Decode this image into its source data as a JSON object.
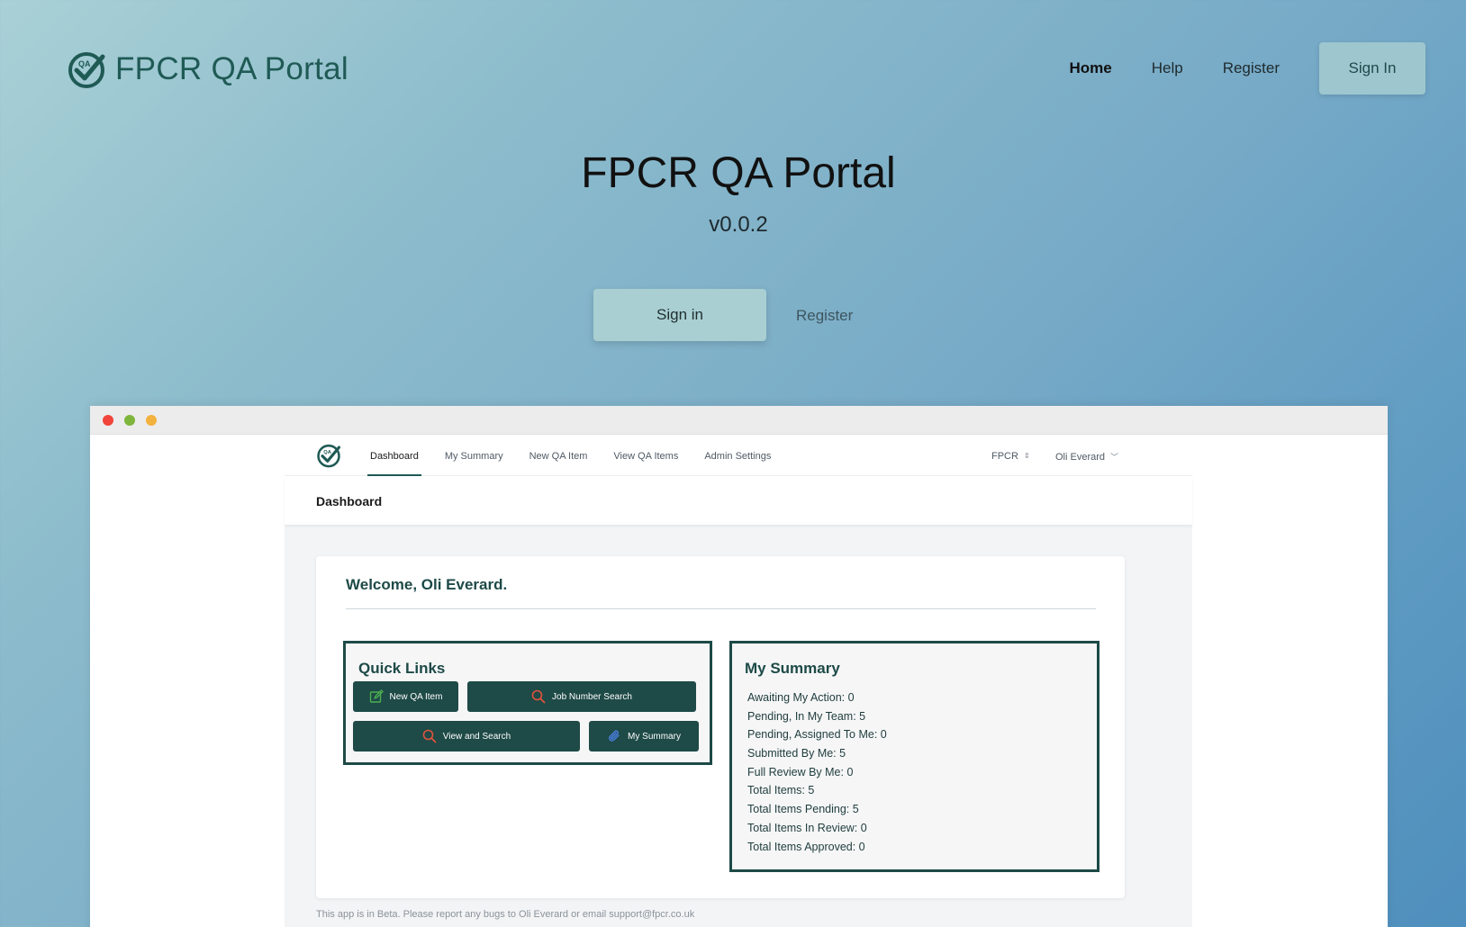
{
  "site": {
    "brand": "FPCR QA Portal",
    "nav": [
      {
        "label": "Home",
        "active": true
      },
      {
        "label": "Help",
        "active": false
      },
      {
        "label": "Register",
        "active": false
      }
    ],
    "nav_signin": "Sign In"
  },
  "hero": {
    "title": "FPCR QA Portal",
    "version": "v0.0.2",
    "signin": "Sign in",
    "register": "Register"
  },
  "app": {
    "logo_text": "QA",
    "tabs": [
      {
        "label": "Dashboard",
        "active": true
      },
      {
        "label": "My Summary",
        "active": false
      },
      {
        "label": "New QA Item",
        "active": false
      },
      {
        "label": "View QA Items",
        "active": false
      },
      {
        "label": "Admin Settings",
        "active": false
      }
    ],
    "org": "FPCR",
    "user": "Oli Everard",
    "page_title": "Dashboard",
    "welcome": "Welcome, Oli Everard.",
    "quick_links": {
      "title": "Quick Links",
      "buttons": [
        {
          "label": "New QA Item",
          "icon": "edit-icon"
        },
        {
          "label": "Job Number Search",
          "icon": "search-icon"
        },
        {
          "label": "View and Search",
          "icon": "search-icon"
        },
        {
          "label": "My Summary",
          "icon": "paperclip-icon"
        }
      ]
    },
    "summary": {
      "title": "My Summary",
      "items": [
        "Awaiting My Action: 0",
        "Pending, In My Team: 5",
        "Pending, Assigned To Me: 0",
        "Submitted By Me: 5",
        "Full Review By Me: 0",
        "Total Items: 5",
        "Total Items Pending: 5",
        "Total Items In Review: 0",
        "Total Items Approved: 0"
      ]
    },
    "footer": "This app is in Beta. Please report any bugs to Oli Everard or email support@fpcr.co.uk"
  },
  "colors": {
    "brand": "#1f5a55",
    "button_dark": "#1e4a47",
    "accent_light": "#a9cfd2"
  }
}
